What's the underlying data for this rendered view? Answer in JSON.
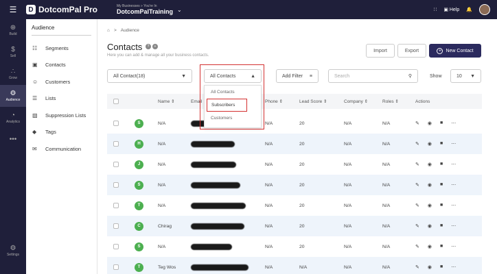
{
  "brand": {
    "name": "DotcomPal Pro",
    "logo": "D"
  },
  "business": {
    "label": "My Businesses » You're In",
    "name": "DotcomPalTraining"
  },
  "topbar": {
    "help_label": "Help"
  },
  "rail": [
    {
      "name": "build",
      "label": "Build",
      "icon": "⊕"
    },
    {
      "name": "sell",
      "label": "Sell",
      "icon": "$"
    },
    {
      "name": "grow",
      "label": "Grow",
      "icon": "∴"
    },
    {
      "name": "audience",
      "label": "Audience",
      "icon": "⚙"
    },
    {
      "name": "analytics",
      "label": "Analytics",
      "icon": "◔"
    },
    {
      "name": "more",
      "label": "",
      "icon": "•••"
    }
  ],
  "rail_settings": {
    "label": "Settings",
    "icon": "⚙"
  },
  "subnav": {
    "title": "Audience",
    "items": [
      {
        "label": "Segments",
        "icon": "☷"
      },
      {
        "label": "Contacts",
        "icon": "▣"
      },
      {
        "label": "Customers",
        "icon": "☺"
      },
      {
        "label": "Lists",
        "icon": "☰"
      },
      {
        "label": "Suppression Lists",
        "icon": "▧"
      },
      {
        "label": "Tags",
        "icon": "◆"
      },
      {
        "label": "Communication",
        "icon": "✉"
      }
    ]
  },
  "breadcrumb": {
    "home_icon": "⌂",
    "sep": ">",
    "current": "Audience"
  },
  "page": {
    "title": "Contacts",
    "subtitle": "Here you can add & manage all your business contacts."
  },
  "buttons": {
    "import": "Import",
    "export": "Export",
    "new_contact": "New Contact"
  },
  "filters": {
    "all_contact": "All Contact(18)",
    "type_select": "All Contacts",
    "add_filter": "Add Filter",
    "search_placeholder": "Search",
    "show_label": "Show",
    "show_value": "10"
  },
  "dropdown": {
    "options": [
      "All Contacts",
      "Subscribers",
      "Customers"
    ]
  },
  "table": {
    "headers": {
      "name": "Name ⇕",
      "email": "Email",
      "phone": "Phone ⇕",
      "lead": "Lead Score ⇕",
      "company": "Company ⇕",
      "roles": "Roles ⇕",
      "actions": "Actions"
    },
    "rows": [
      {
        "initial": "S",
        "name": "N/A",
        "phone": "N/A",
        "lead": "20",
        "company": "N/A",
        "roles": "N/A"
      },
      {
        "initial": "H",
        "name": "N/A",
        "phone": "N/A",
        "lead": "20",
        "company": "N/A",
        "roles": "N/A"
      },
      {
        "initial": "J",
        "name": "N/A",
        "phone": "N/A",
        "lead": "20",
        "company": "N/A",
        "roles": "N/A"
      },
      {
        "initial": "S",
        "name": "N/A",
        "phone": "N/A",
        "lead": "20",
        "company": "N/A",
        "roles": "N/A"
      },
      {
        "initial": "T",
        "name": "N/A",
        "phone": "N/A",
        "lead": "20",
        "company": "N/A",
        "roles": "N/A"
      },
      {
        "initial": "C",
        "name": "Chirag",
        "phone": "N/A",
        "lead": "20",
        "company": "N/A",
        "roles": "N/A"
      },
      {
        "initial": "S",
        "name": "N/A",
        "phone": "N/A",
        "lead": "20",
        "company": "N/A",
        "roles": "N/A"
      },
      {
        "initial": "T",
        "name": "Teg Wos",
        "phone": "N/A",
        "lead": "N/A",
        "company": "N/A",
        "roles": "N/A"
      }
    ]
  },
  "colors": {
    "nav_bg": "#1f1f3a",
    "accent": "#2b2a5e",
    "avatar_green": "#4caf50",
    "highlight_red": "#d32f2f"
  }
}
